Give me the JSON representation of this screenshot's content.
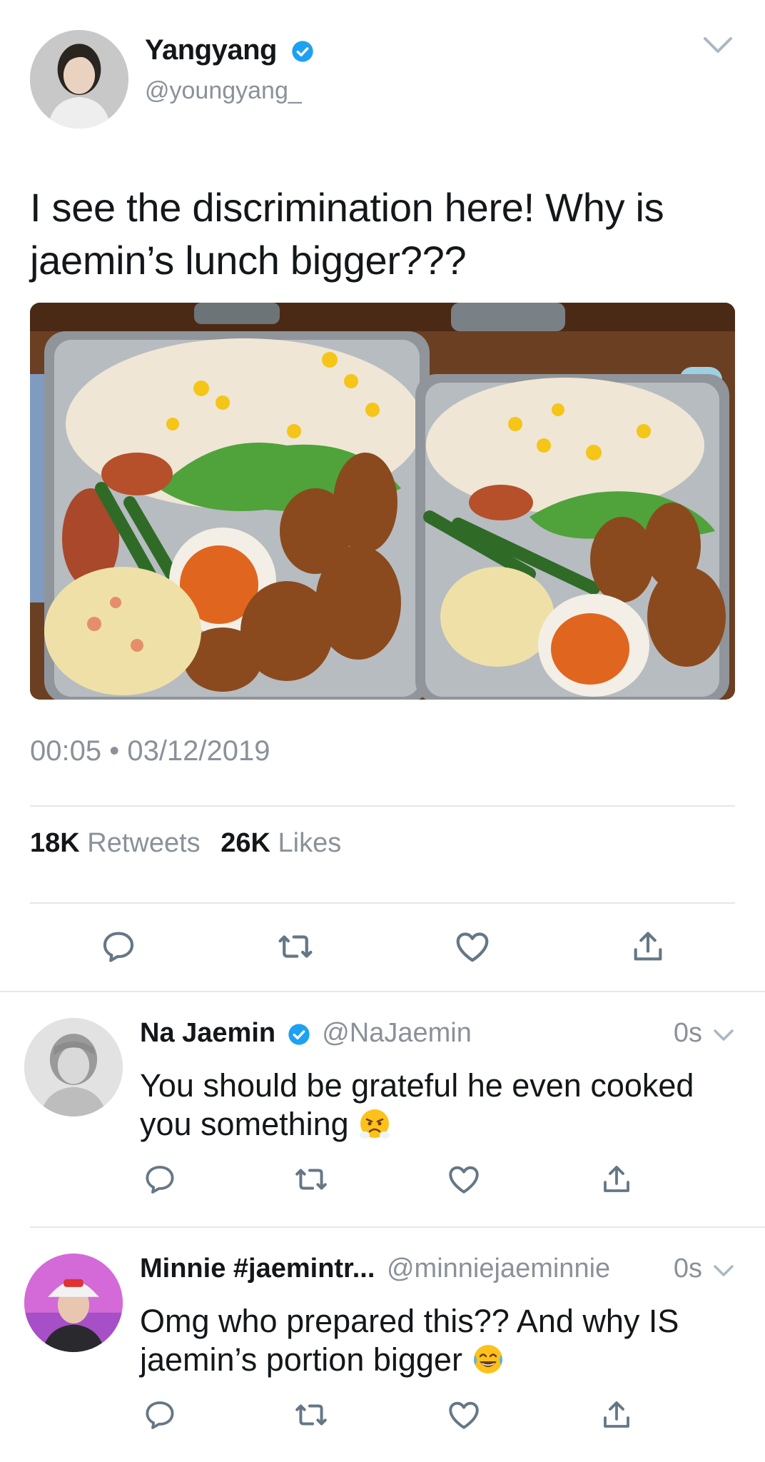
{
  "tweet": {
    "author_name": "Yangyang",
    "author_handle": "@youngyang_",
    "text": "I see the discrimination here! Why is jaemin’s lunch bigger???",
    "timestamp": "00:05 • 03/12/2019",
    "retweets_count": "18K",
    "retweets_label": "Retweets",
    "likes_count": "26K",
    "likes_label": "Likes",
    "media_icon": "photo-bento-lunchboxes"
  },
  "replies": [
    {
      "name": "Na Jaemin",
      "verified": true,
      "handle": "@NaJaemin",
      "time": "0s",
      "text": "You should be grateful he even cooked you something",
      "emoji": "face-with-steam-from-nose"
    },
    {
      "name": "Minnie #jaemintr...",
      "verified": false,
      "handle": "@minniejaeminnie",
      "time": "0s",
      "text": "Omg who prepared this?? And why IS jaemin’s portion bigger",
      "emoji": "face-with-tears-of-joy"
    }
  ],
  "actions": [
    "reply-icon",
    "retweet-icon",
    "like-icon",
    "share-icon"
  ],
  "colors": {
    "verified": "#1da1f2",
    "text_primary": "#14171a",
    "text_secondary": "#8a9199",
    "icon": "#657786",
    "divider": "#e1e8ed"
  }
}
